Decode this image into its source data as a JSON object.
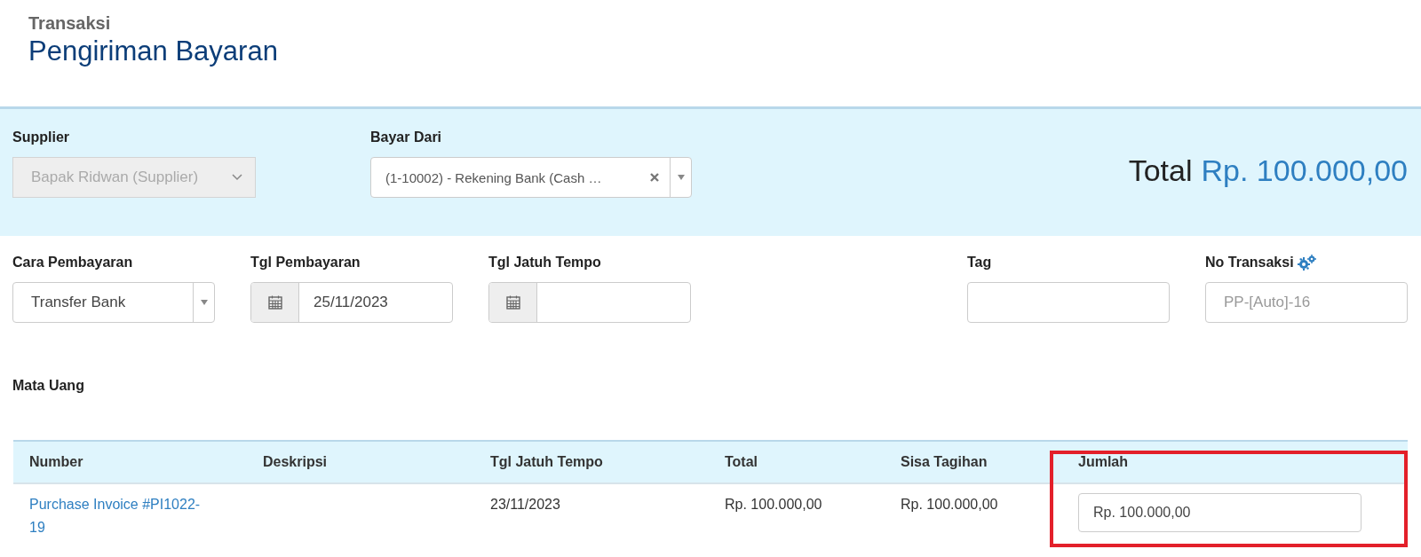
{
  "header": {
    "breadcrumb": "Transaksi",
    "title": "Pengiriman Bayaran"
  },
  "top_panel": {
    "supplier": {
      "label": "Supplier",
      "value": "Bapak Ridwan (Supplier)",
      "disabled": true
    },
    "pay_from": {
      "label": "Bayar Dari",
      "value": "(1-10002) - Rekening Bank (Cash …",
      "clearable": true
    },
    "total": {
      "label": "Total",
      "value": "Rp. 100.000,00"
    }
  },
  "fields": [
    {
      "kind": "select",
      "label": "Cara Pembayaran",
      "value": "Transfer Bank"
    },
    {
      "kind": "date",
      "label": "Tgl Pembayaran",
      "value": "25/11/2023"
    },
    {
      "kind": "date",
      "label": "Tgl Jatuh Tempo"
    },
    {
      "kind": "spacer"
    },
    {
      "kind": "text",
      "label": "Tag"
    },
    {
      "kind": "auto",
      "label": "No Transaksi",
      "placeholder": "PP-[Auto]-16"
    }
  ],
  "currency": {
    "label": "Mata Uang"
  },
  "table": {
    "columns": [
      "Number",
      "Deskripsi",
      "Tgl Jatuh Tempo",
      "Total",
      "Sisa Tagihan",
      "Jumlah"
    ],
    "rows": [
      {
        "number": "Purchase Invoice #PI1022-19",
        "due_date": "23/11/2023",
        "total": "Rp. 100.000,00",
        "remaining": "Rp. 100.000,00",
        "amount": "Rp. 100.000,00"
      }
    ]
  }
}
